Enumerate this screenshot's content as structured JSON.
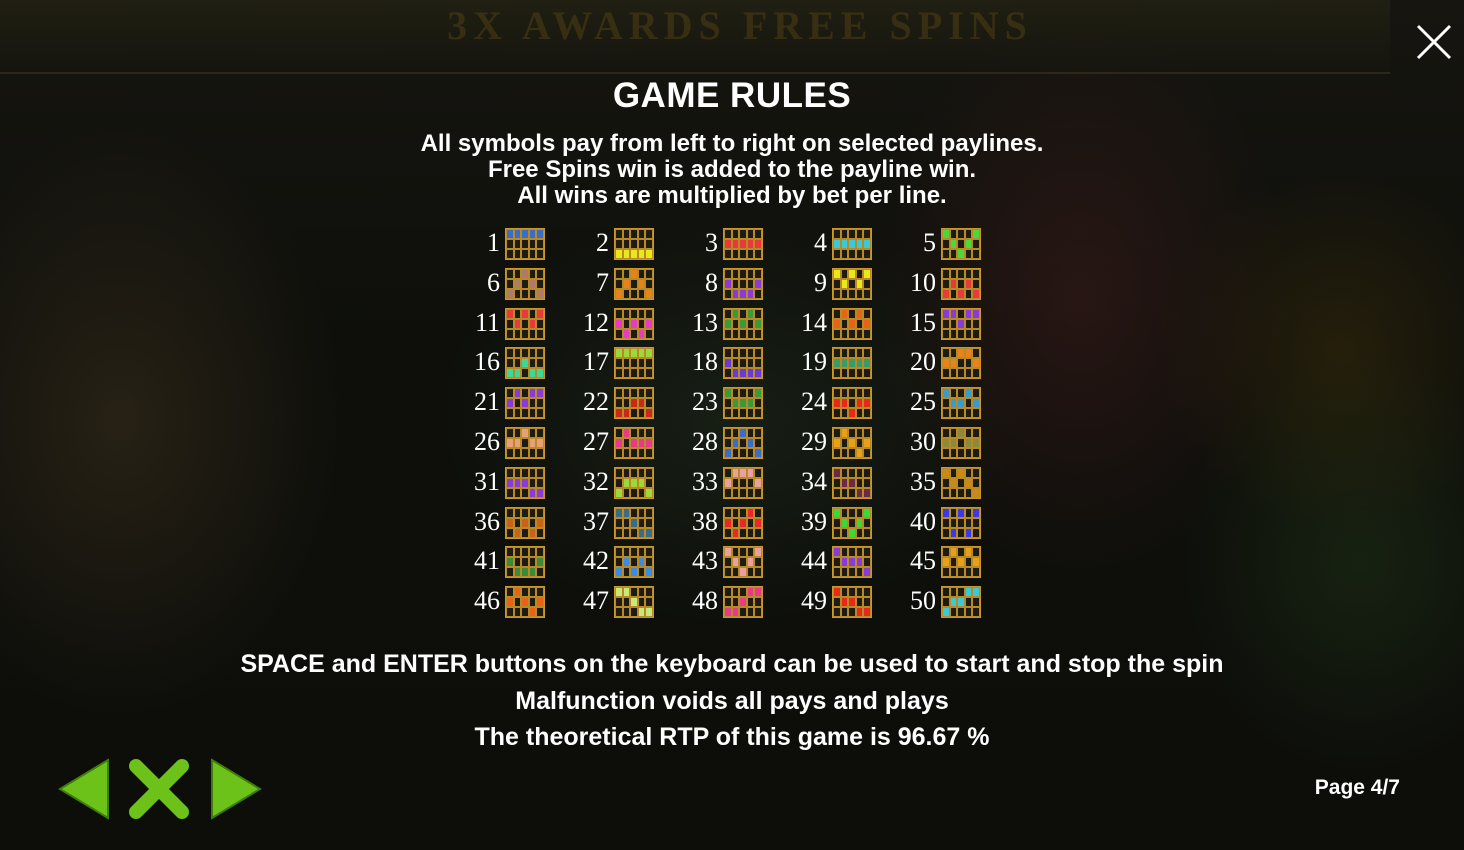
{
  "background_banner": {
    "text": "3X AWARDS FREE SPINS"
  },
  "close_button": {
    "icon": "close-icon"
  },
  "title": "GAME RULES",
  "intro_lines": [
    "All symbols pay from left to right on selected paylines.",
    "Free Spins win is added to the payline win.",
    "All wins are multiplied by bet per line."
  ],
  "paylines": [
    {
      "n": "1",
      "color": "#3a6cc9",
      "rows": [
        0,
        0,
        0,
        0,
        0
      ]
    },
    {
      "n": "2",
      "color": "#e8e81a",
      "rows": [
        2,
        2,
        2,
        2,
        2
      ]
    },
    {
      "n": "3",
      "color": "#e83a3a",
      "rows": [
        1,
        1,
        1,
        1,
        1
      ]
    },
    {
      "n": "4",
      "color": "#3ac9d9",
      "rows": [
        1,
        1,
        1,
        1,
        1
      ]
    },
    {
      "n": "5",
      "color": "#4ad93a",
      "rows": [
        0,
        1,
        2,
        1,
        0
      ]
    },
    {
      "n": "6",
      "color": "#b07a6a",
      "rows": [
        2,
        1,
        0,
        1,
        2
      ]
    },
    {
      "n": "7",
      "color": "#e8821a",
      "rows": [
        2,
        1,
        0,
        1,
        2
      ]
    },
    {
      "n": "8",
      "color": "#8a3ad9",
      "rows": [
        1,
        2,
        2,
        2,
        1
      ]
    },
    {
      "n": "9",
      "color": "#e8e81a",
      "rows": [
        0,
        1,
        0,
        1,
        0
      ]
    },
    {
      "n": "10",
      "color": "#e83a3a",
      "rows": [
        2,
        1,
        2,
        1,
        2
      ]
    },
    {
      "n": "11",
      "color": "#e83a3a",
      "rows": [
        0,
        1,
        0,
        1,
        0
      ]
    },
    {
      "n": "12",
      "color": "#e83ac9",
      "rows": [
        1,
        2,
        1,
        2,
        1
      ]
    },
    {
      "n": "13",
      "color": "#3a9a3a",
      "rows": [
        1,
        0,
        1,
        0,
        1
      ]
    },
    {
      "n": "14",
      "color": "#e8621a",
      "rows": [
        1,
        0,
        1,
        0,
        1
      ]
    },
    {
      "n": "15",
      "color": "#8a3ad9",
      "rows": [
        0,
        0,
        1,
        0,
        0
      ]
    },
    {
      "n": "16",
      "color": "#3ad99a",
      "rows": [
        2,
        2,
        1,
        2,
        2
      ]
    },
    {
      "n": "17",
      "color": "#9ad93a",
      "rows": [
        0,
        0,
        0,
        0,
        0
      ]
    },
    {
      "n": "18",
      "color": "#6a3ad9",
      "rows": [
        1,
        2,
        2,
        2,
        2
      ]
    },
    {
      "n": "19",
      "color": "#3a9a6a",
      "rows": [
        1,
        1,
        1,
        1,
        1
      ]
    },
    {
      "n": "20",
      "color": "#e8821a",
      "rows": [
        1,
        1,
        0,
        0,
        1
      ]
    },
    {
      "n": "21",
      "color": "#8a3ad9",
      "rows": [
        1,
        0,
        1,
        0,
        0
      ]
    },
    {
      "n": "22",
      "color": "#c9281a",
      "rows": [
        2,
        2,
        1,
        1,
        2
      ]
    },
    {
      "n": "23",
      "color": "#3a9a3a",
      "rows": [
        0,
        1,
        1,
        1,
        0
      ]
    },
    {
      "n": "24",
      "color": "#e8281a",
      "rows": [
        1,
        1,
        2,
        1,
        1
      ]
    },
    {
      "n": "25",
      "color": "#3a9ac9",
      "rows": [
        0,
        1,
        1,
        0,
        1
      ]
    },
    {
      "n": "26",
      "color": "#e8a07a",
      "rows": [
        1,
        1,
        0,
        1,
        1
      ]
    },
    {
      "n": "27",
      "color": "#e83a8a",
      "rows": [
        1,
        0,
        1,
        1,
        1
      ]
    },
    {
      "n": "28",
      "color": "#3a6cc9",
      "rows": [
        2,
        1,
        0,
        1,
        2
      ]
    },
    {
      "n": "29",
      "color": "#e8a01a",
      "rows": [
        1,
        0,
        1,
        2,
        1
      ]
    },
    {
      "n": "30",
      "color": "#8a8a3a",
      "rows": [
        1,
        1,
        0,
        1,
        1
      ]
    },
    {
      "n": "31",
      "color": "#8a3ad9",
      "rows": [
        1,
        1,
        1,
        2,
        2
      ]
    },
    {
      "n": "32",
      "color": "#9ad93a",
      "rows": [
        2,
        1,
        1,
        1,
        2
      ]
    },
    {
      "n": "33",
      "color": "#e8a0a0",
      "rows": [
        1,
        0,
        0,
        0,
        1
      ]
    },
    {
      "n": "34",
      "color": "#6a2a4a",
      "rows": [
        0,
        1,
        1,
        2,
        2
      ]
    },
    {
      "n": "35",
      "color": "#c98a1a",
      "rows": [
        0,
        1,
        0,
        1,
        2
      ]
    },
    {
      "n": "36",
      "color": "#c9621a",
      "rows": [
        1,
        2,
        1,
        2,
        1
      ]
    },
    {
      "n": "37",
      "color": "#3a6c8a",
      "rows": [
        0,
        0,
        1,
        2,
        2
      ]
    },
    {
      "n": "38",
      "color": "#e8282a",
      "rows": [
        1,
        2,
        1,
        0,
        1
      ]
    },
    {
      "n": "39",
      "color": "#3ad93a",
      "rows": [
        0,
        1,
        2,
        1,
        0
      ]
    },
    {
      "n": "40",
      "color": "#3a3ae8",
      "rows": [
        0,
        2,
        0,
        2,
        0
      ]
    },
    {
      "n": "41",
      "color": "#3a8a3a",
      "rows": [
        1,
        2,
        2,
        2,
        1
      ]
    },
    {
      "n": "42",
      "color": "#3a8ae8",
      "rows": [
        2,
        1,
        2,
        1,
        2
      ]
    },
    {
      "n": "43",
      "color": "#e8a0a0",
      "rows": [
        0,
        1,
        2,
        1,
        0
      ]
    },
    {
      "n": "44",
      "color": "#8a3ad9",
      "rows": [
        0,
        1,
        1,
        1,
        2
      ]
    },
    {
      "n": "45",
      "color": "#e8a01a",
      "rows": [
        1,
        0,
        1,
        0,
        1
      ]
    },
    {
      "n": "46",
      "color": "#e8621a",
      "rows": [
        1,
        0,
        1,
        2,
        1
      ]
    },
    {
      "n": "47",
      "color": "#c9e87a",
      "rows": [
        0,
        0,
        1,
        2,
        2
      ]
    },
    {
      "n": "48",
      "color": "#e83a8a",
      "rows": [
        2,
        2,
        1,
        0,
        0
      ]
    },
    {
      "n": "49",
      "color": "#e8281a",
      "rows": [
        0,
        1,
        1,
        2,
        2
      ]
    },
    {
      "n": "50",
      "color": "#3ac9d9",
      "rows": [
        2,
        1,
        1,
        0,
        0
      ]
    }
  ],
  "footer_lines": [
    "SPACE and ENTER buttons on the keyboard can be used to start and stop the spin",
    "Malfunction voids all pays and plays",
    "The theoretical RTP of this game is 96.67 %"
  ],
  "nav": {
    "prev_icon": "arrow-left-icon",
    "close_icon": "close-x-icon",
    "next_icon": "arrow-right-icon",
    "accent": "#6dc21a"
  },
  "page_indicator": "Page 4/7"
}
